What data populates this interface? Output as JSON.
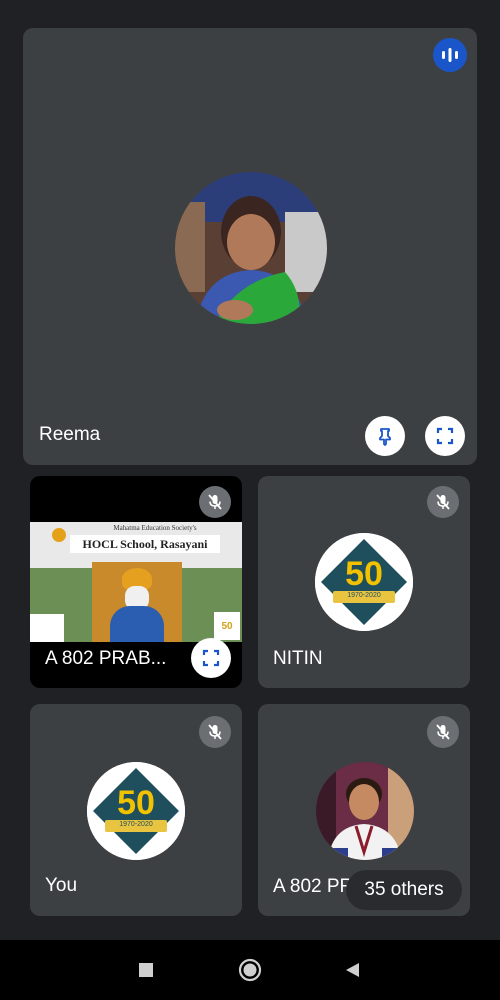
{
  "participants": {
    "main": {
      "name": "Reema"
    },
    "screen_share": {
      "name": "A 802 PRAB...",
      "slide_title": "HOCL School, Rasayani",
      "slide_subtitle": "Mahatma Education Society's",
      "logo_number": "50"
    },
    "nitin": {
      "name": "NITIN",
      "logo_number": "50",
      "logo_years": "1970-2020"
    },
    "you": {
      "name": "You",
      "logo_number": "50",
      "logo_years": "1970-2020"
    },
    "prabhat": {
      "name": "A 802 PRABHAT K"
    }
  },
  "others_badge": "35 others",
  "icons": {
    "speaking": "audio-level-icon",
    "pin": "pin-icon",
    "fullscreen": "fullscreen-icon",
    "mic_off": "mic-off-icon"
  },
  "colors": {
    "background": "#202124",
    "tile": "#3c4043",
    "accent_blue": "#1a56c9"
  }
}
